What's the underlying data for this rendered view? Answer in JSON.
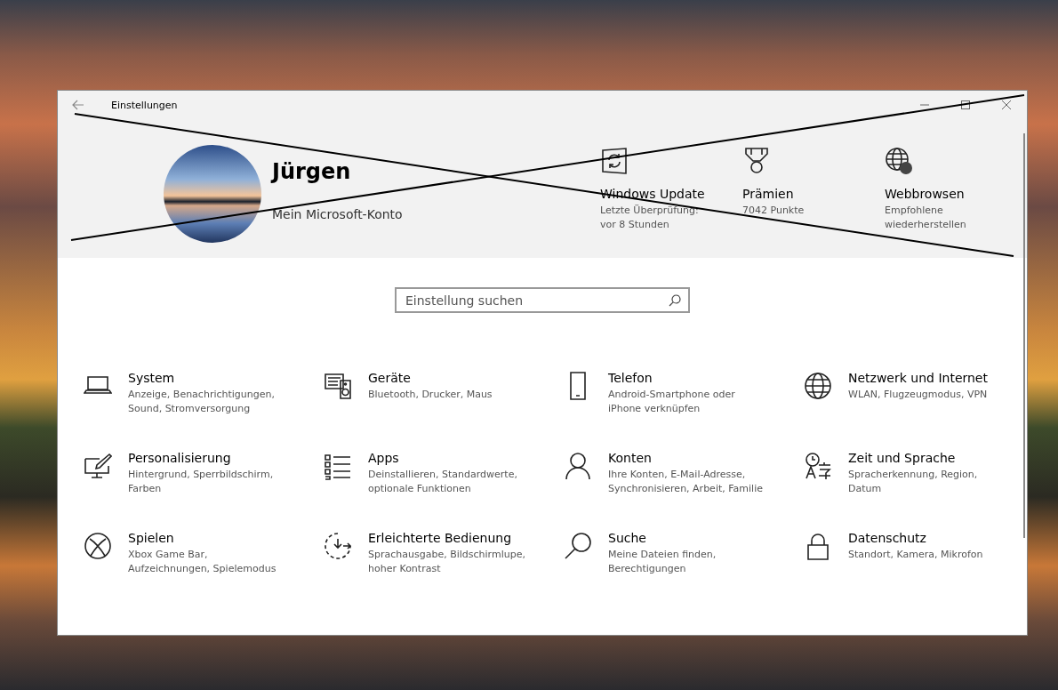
{
  "window": {
    "title": "Einstellungen"
  },
  "account": {
    "name": "Jürgen",
    "link": "Mein Microsoft-Konto"
  },
  "quick_links": [
    {
      "title": "Windows Update",
      "detail": "Letzte Überprüfung:\nvor 8 Stunden"
    },
    {
      "title": "Prämien",
      "detail": "7042 Punkte"
    },
    {
      "title": "Webbrowsen",
      "detail": "Empfohlene\nwiederherstellen"
    }
  ],
  "search": {
    "placeholder": "Einstellung suchen"
  },
  "categories": [
    {
      "title": "System",
      "detail": "Anzeige, Benachrichtigungen,\nSound, Stromversorgung"
    },
    {
      "title": "Geräte",
      "detail": "Bluetooth, Drucker, Maus"
    },
    {
      "title": "Telefon",
      "detail": "Android-Smartphone oder\niPhone verknüpfen"
    },
    {
      "title": "Netzwerk und Internet",
      "detail": "WLAN, Flugzeugmodus, VPN"
    },
    {
      "title": "Personalisierung",
      "detail": "Hintergrund, Sperrbildschirm,\nFarben"
    },
    {
      "title": "Apps",
      "detail": "Deinstallieren, Standardwerte,\noptionale Funktionen"
    },
    {
      "title": "Konten",
      "detail": "Ihre Konten, E-Mail-Adresse,\nSynchronisieren, Arbeit, Familie"
    },
    {
      "title": "Zeit und Sprache",
      "detail": "Spracherkennung, Region,\nDatum"
    },
    {
      "title": "Spielen",
      "detail": "Xbox Game Bar,\nAufzeichnungen, Spielemodus"
    },
    {
      "title": "Erleichterte Bedienung",
      "detail": "Sprachausgabe, Bildschirmlupe,\nhoher Kontrast"
    },
    {
      "title": "Suche",
      "detail": "Meine Dateien finden,\nBerechtigungen"
    },
    {
      "title": "Datenschutz",
      "detail": "Standort, Kamera, Mikrofon"
    }
  ]
}
